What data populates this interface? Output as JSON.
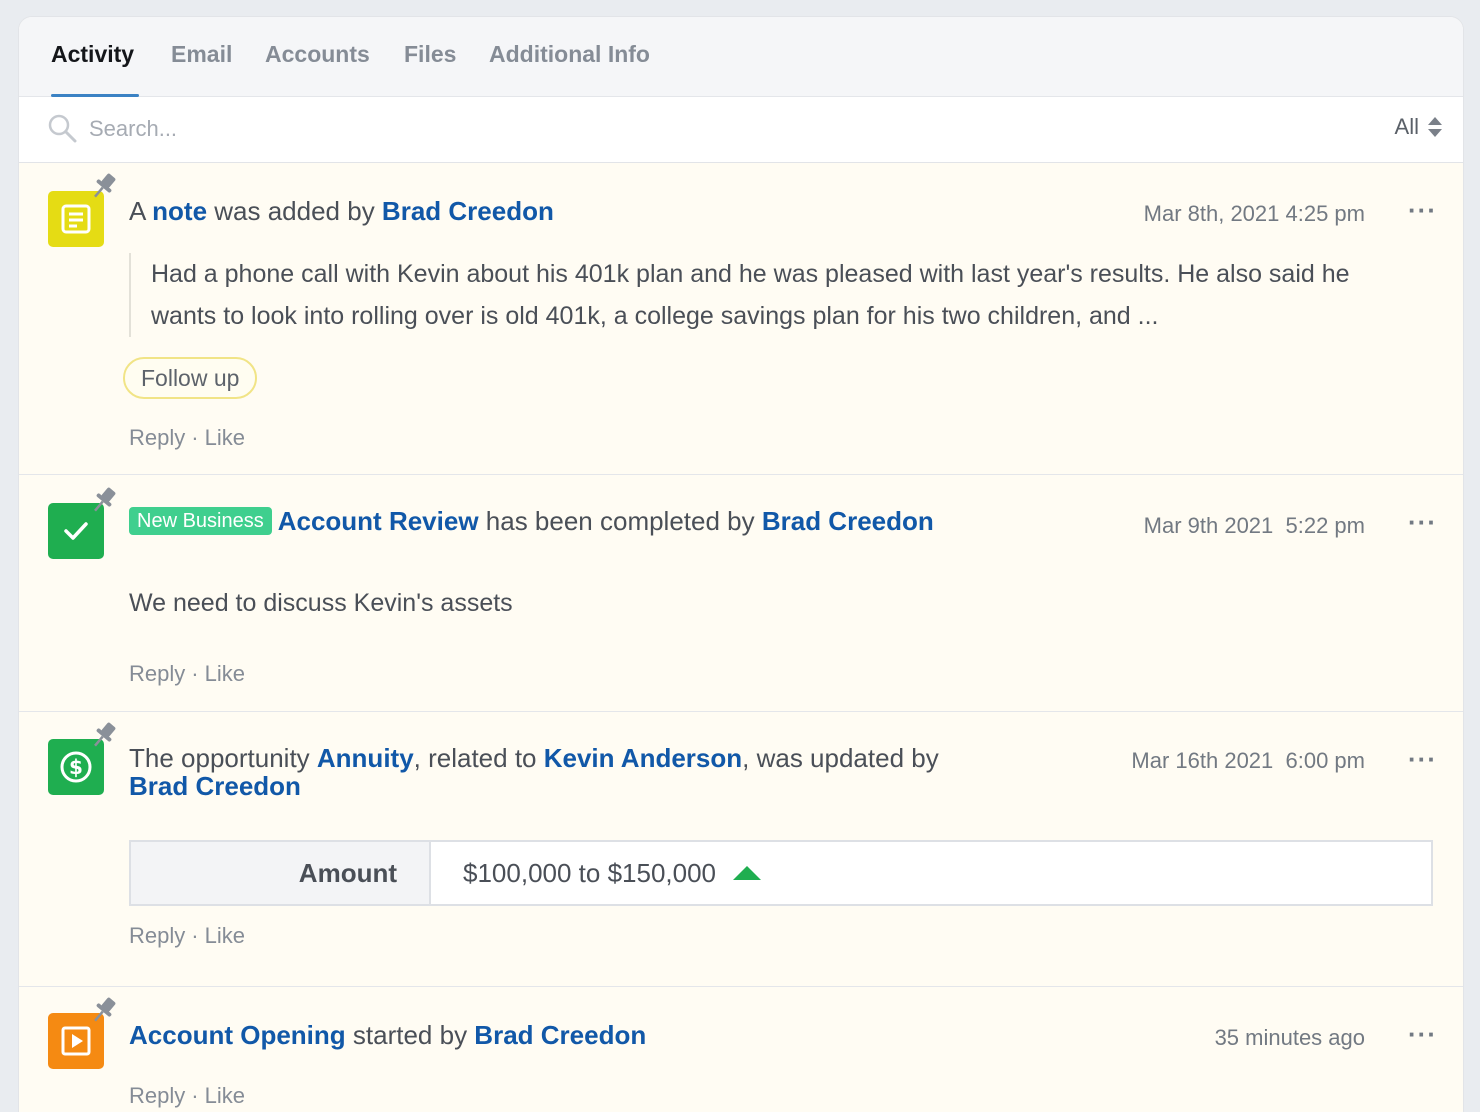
{
  "tabs": [
    {
      "label": "Activity"
    },
    {
      "label": "Email"
    },
    {
      "label": "Accounts"
    },
    {
      "label": "Files"
    },
    {
      "label": "Additional Info"
    }
  ],
  "search": {
    "placeholder": "Search..."
  },
  "filter": {
    "label": "All"
  },
  "feed": {
    "note": {
      "prefix": "A ",
      "link1": "note",
      "mid": " was added by ",
      "author": "Brad Creedon",
      "time": "Mar 8th, 2021 4:25 pm",
      "body": "Had a phone call with Kevin about his 401k plan and he was pleased with last year's results. He also said he wants to look into rolling over is old 401k, a college savings plan for his two children, and ...",
      "tag": "Follow up"
    },
    "review": {
      "label": "New Business",
      "link1": "Account Review",
      "mid": " has been completed by ",
      "author": "Brad Creedon",
      "time": "Mar 9th 2021  5:22 pm",
      "body": "We need to discuss Kevin's assets"
    },
    "opportunity": {
      "prefix": "The opportunity ",
      "link1": "Annuity",
      "mid1": ", related to ",
      "link2": "Kevin Anderson",
      "mid2": ", was updated by",
      "author": "Brad Creedon",
      "time": "Mar 16th 2021  6:00 pm",
      "field": "Amount",
      "change": "$100,000 to $150,000"
    },
    "opening": {
      "link1": "Account Opening",
      "mid": " started by ",
      "author": "Brad Creedon",
      "time": "35 minutes ago"
    }
  },
  "actions": {
    "reply": "Reply",
    "sep": "·",
    "like": "Like"
  },
  "more": "···",
  "colors": {
    "note": "#e5dc14",
    "review": "#1fae50",
    "opportunity": "#1fae50",
    "opening": "#f58a12",
    "link": "#1158a8",
    "up_arrow": "#1fae50"
  }
}
